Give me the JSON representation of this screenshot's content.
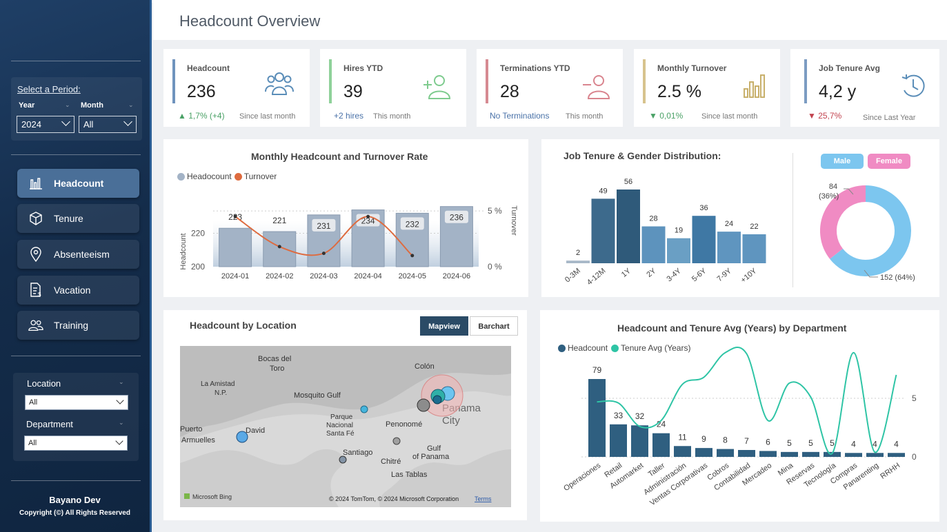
{
  "page": {
    "title": "Headcount Overview"
  },
  "sidebar": {
    "period_title": "Select a Period:",
    "year_label": "Year",
    "month_label": "Month",
    "year_value": "2024",
    "month_value": "All",
    "nav": [
      {
        "label": "Headcount"
      },
      {
        "label": "Tenure"
      },
      {
        "label": "Absenteeism"
      },
      {
        "label": "Vacation"
      },
      {
        "label": "Training"
      }
    ],
    "location_label": "Location",
    "location_value": "All",
    "department_label": "Department",
    "department_value": "All",
    "brand_name": "Bayano Dev",
    "copyright": "Copyright (©) All Rights Reserved"
  },
  "kpis": [
    {
      "label": "Headcount",
      "value": "236",
      "delta": "▲ 1,7% (+4)",
      "since": "Since last month",
      "color": "#6f93bd"
    },
    {
      "label": "Hires YTD",
      "value": "39",
      "delta": "+2 hires",
      "since": "This month",
      "color": "#8fd19a"
    },
    {
      "label": "Terminations YTD",
      "value": "28",
      "delta": "No Terminations",
      "since": "This month",
      "color": "#d68a92"
    },
    {
      "label": "Monthly Turnover",
      "value": "2.5 %",
      "delta": "▼ 0,01%",
      "since": "Since last month",
      "color": "#d7c38d"
    },
    {
      "label": "Job Tenure Avg",
      "value": "4,2 y",
      "delta": "▼ 25,7%",
      "since": "Since Last Year",
      "color": "#7c9cc2"
    }
  ],
  "monthly_chart": {
    "title": "Monthly Headcount and Turnover Rate",
    "legend_headcount": "Headocount",
    "legend_turnover": "Turnover",
    "ylabel_left": "Headcount",
    "ylabel_right": "Turnover",
    "colors": {
      "bar": "#a3b3c6",
      "line": "#de6b3f"
    }
  },
  "tenure_chart": {
    "title": "Job Tenure & Gender Distribution:",
    "male_label": "Male",
    "female_label": "Female",
    "female_label_value": "84",
    "female_label_pct": "(36%)",
    "male_label_text": "152 (64%)",
    "colors": {
      "male": "#7cc6ef",
      "female": "#f08bc3"
    }
  },
  "location_map": {
    "title": "Headcount by Location",
    "btn_mapview": "Mapview",
    "btn_barchart": "Barchart",
    "places": [
      {
        "name": "Bocas del",
        "name2": "Toro"
      },
      {
        "name": "Colón"
      },
      {
        "name": "La Amistad",
        "name2": "N.P."
      },
      {
        "name": "Mosquito Gulf"
      },
      {
        "name": "Panama",
        "name2": "City"
      },
      {
        "name": "Parque",
        "name2": "Nacional",
        "name3": "Santa Fé"
      },
      {
        "name": "Penonomé"
      },
      {
        "name": "Puerto",
        "name2": "Armuelles"
      },
      {
        "name": "David"
      },
      {
        "name": "Gulf",
        "name2": "of Panama"
      },
      {
        "name": "Santiago"
      },
      {
        "name": "Chitré"
      },
      {
        "name": "Las Tablas"
      }
    ],
    "attribution_logo": "Microsoft Bing",
    "attribution": "© 2024 TomTom, © 2024 Microsoft Corporation",
    "terms": "Terms"
  },
  "dept_chart": {
    "title": "Headcount and Tenure Avg (Years) by Department",
    "legend_headcount": "Headcount",
    "legend_tenure": "Tenure Avg (Years)",
    "colors": {
      "bar": "#2f5f80",
      "line": "#2ec4a5"
    }
  },
  "chart_data": [
    {
      "type": "bar",
      "title": "Monthly Headcount and Turnover Rate",
      "categories": [
        "2024-01",
        "2024-02",
        "2024-03",
        "2024-04",
        "2024-05",
        "2024-06"
      ],
      "series": [
        {
          "name": "Headocount",
          "values": [
            223,
            221,
            231,
            234,
            232,
            236
          ]
        },
        {
          "name": "Turnover",
          "values": [
            4.5,
            1.8,
            1.2,
            4.5,
            1.0,
            null
          ]
        }
      ],
      "ylabel": "Headcount",
      "y2label": "Turnover",
      "yticks": [
        "200",
        "220"
      ],
      "y2ticks": [
        "0 %",
        "5 %"
      ],
      "ylim": [
        200,
        240
      ],
      "y2lim": [
        0,
        6
      ]
    },
    {
      "type": "bar",
      "title": "Job Tenure & Gender Distribution:",
      "categories": [
        "0-3M",
        "4-12M",
        "1Y",
        "2Y",
        "3-4Y",
        "5-6Y",
        "7-9Y",
        "+10Y"
      ],
      "values": [
        2,
        49,
        56,
        28,
        19,
        36,
        24,
        22
      ]
    },
    {
      "type": "pie",
      "categories": [
        "Male",
        "Female"
      ],
      "values": [
        152,
        84
      ],
      "percent": [
        64,
        36
      ]
    },
    {
      "type": "bar",
      "title": "Headcount and Tenure Avg (Years) by Department",
      "categories": [
        "Operaciones",
        "Retail",
        "Automarket",
        "Taller",
        "Administración",
        "Ventas Corporativas",
        "Cobros",
        "Contabilidad",
        "Mercadeo",
        "Mina",
        "Reservas",
        "Tecnología",
        "Compras",
        "Panarenting",
        "RRHH"
      ],
      "series": [
        {
          "name": "Headcount",
          "values": [
            79,
            33,
            32,
            24,
            11,
            9,
            8,
            7,
            6,
            5,
            5,
            5,
            4,
            4,
            4
          ]
        },
        {
          "name": "Tenure Avg (Years)",
          "values": [
            4.7,
            4.6,
            2.6,
            3.1,
            6.2,
            6.8,
            8.9,
            8.8,
            3.1,
            6.3,
            5.1,
            0.3,
            8.9,
            0.4,
            7.0
          ]
        }
      ],
      "y2ticks": [
        "0",
        "5"
      ]
    }
  ]
}
